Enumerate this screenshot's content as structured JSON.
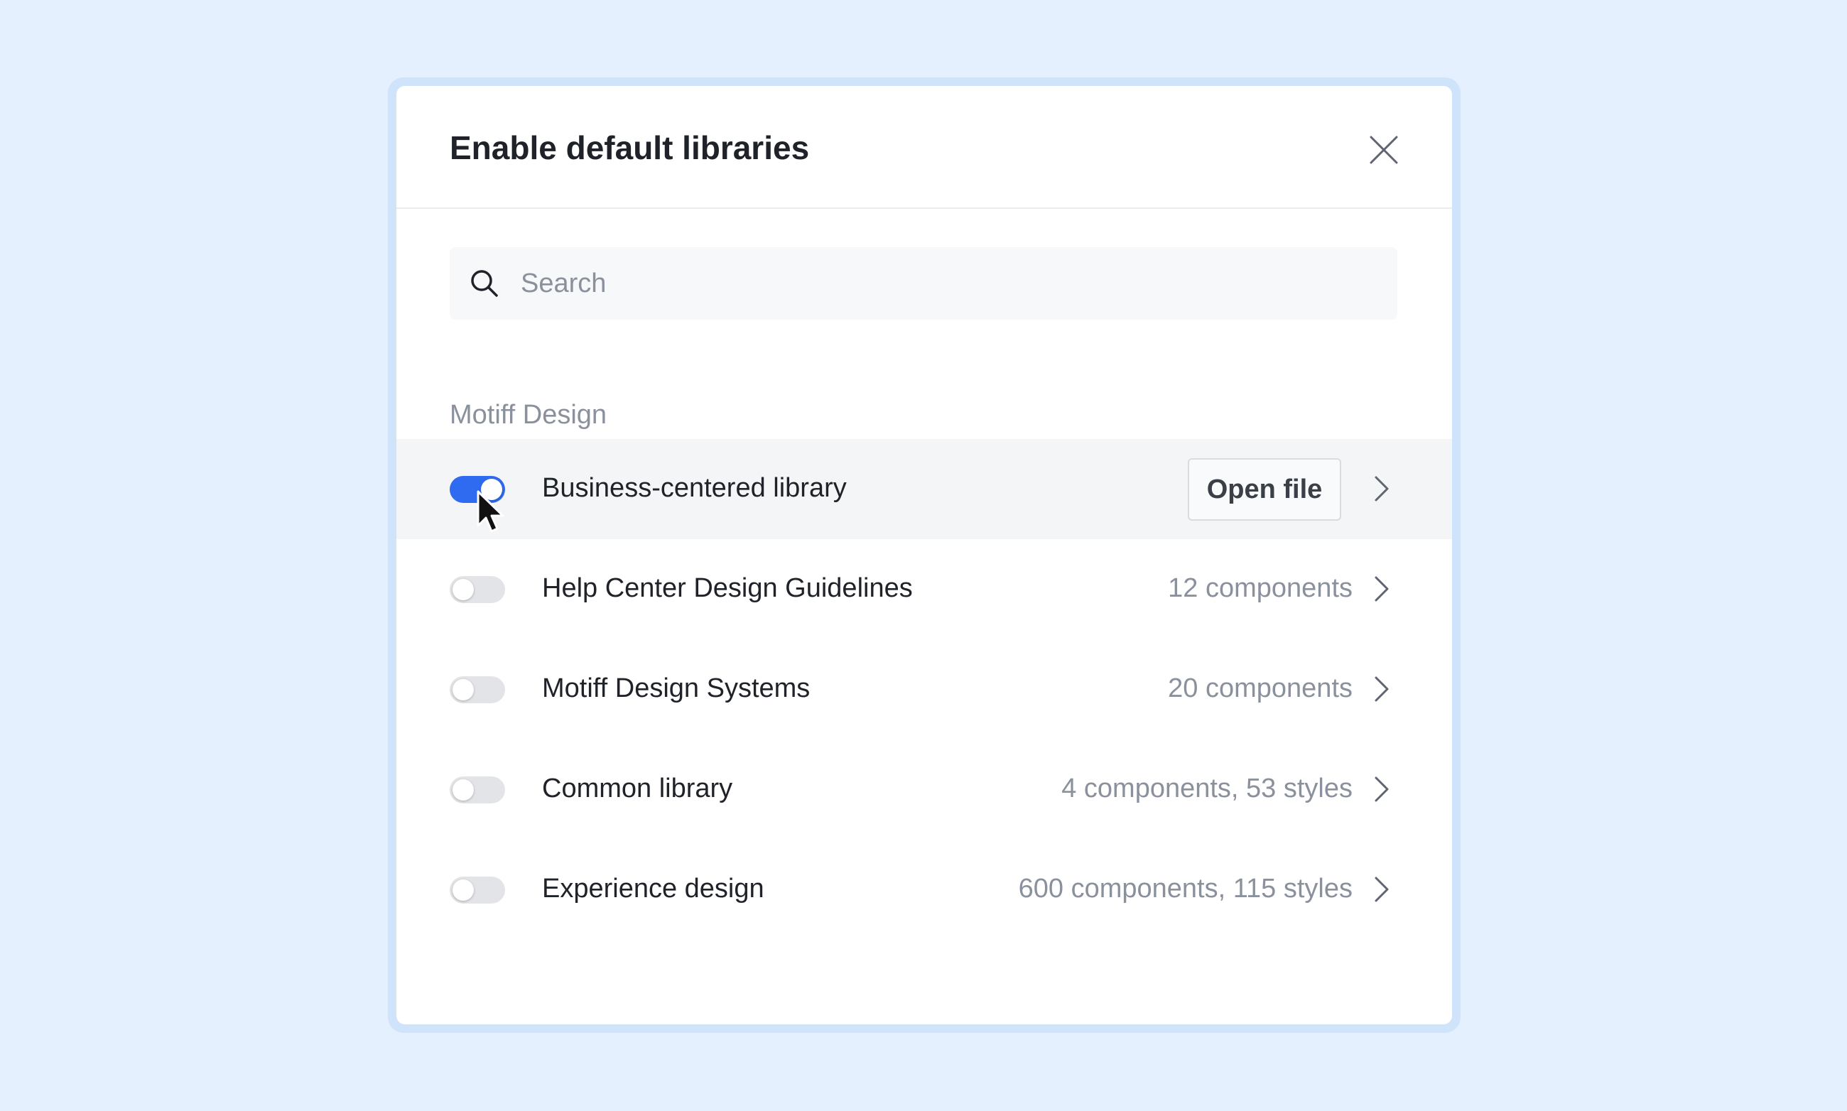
{
  "dialog": {
    "title": "Enable default libraries",
    "close_icon": "close-icon"
  },
  "search": {
    "placeholder": "Search",
    "value": "",
    "icon": "search-icon"
  },
  "section": {
    "title": "Motiff Design"
  },
  "libraries": [
    {
      "name": "Business-centered library",
      "enabled": true,
      "hovered": true,
      "action_label": "Open file",
      "meta": ""
    },
    {
      "name": "Help Center Design Guidelines",
      "enabled": false,
      "hovered": false,
      "action_label": "",
      "meta": "12 components"
    },
    {
      "name": "Motiff Design Systems",
      "enabled": false,
      "hovered": false,
      "action_label": "",
      "meta": "20 components"
    },
    {
      "name": "Common library",
      "enabled": false,
      "hovered": false,
      "action_label": "",
      "meta": "4 components, 53 styles"
    },
    {
      "name": "Experience design",
      "enabled": false,
      "hovered": false,
      "action_label": "",
      "meta": "600 components, 115 styles"
    }
  ],
  "colors": {
    "page_background": "#e4f0fd",
    "dialog_frame": "#cfe3fb",
    "toggle_on": "#2f6bf0",
    "toggle_off": "#e3e4e7",
    "hover_row": "#f4f5f6",
    "muted_text": "#8a919d"
  }
}
